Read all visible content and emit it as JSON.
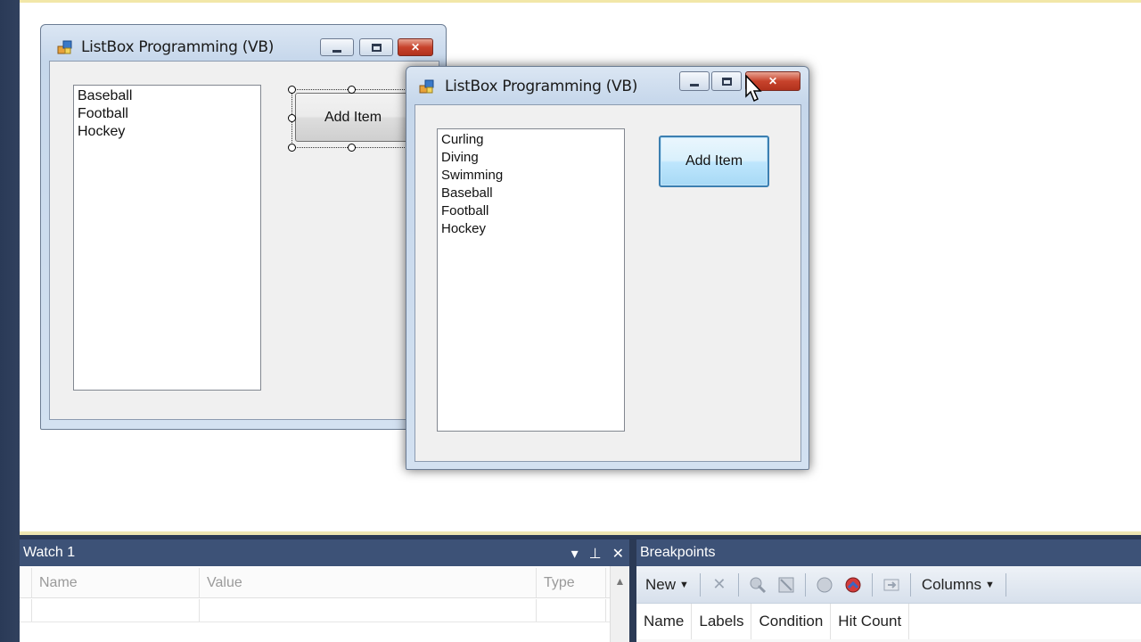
{
  "colors": {
    "ide_dark": "#2b3a55",
    "panel_header": "#3d5277",
    "designer_bg": "#ffffff",
    "focus_blue": "#3c7fb1",
    "close_red": "#c7432c"
  },
  "design_form": {
    "title": "ListBox Programming (VB)",
    "listbox_items": [
      "Baseball",
      "Football",
      "Hockey"
    ],
    "button_label": "Add Item"
  },
  "running_form": {
    "title": "ListBox Programming (VB)",
    "listbox_items": [
      "Curling",
      "Diving",
      "Swimming",
      "Baseball",
      "Football",
      "Hockey"
    ],
    "button_label": "Add Item"
  },
  "watch_panel": {
    "title": "Watch 1",
    "columns": [
      "Name",
      "Value",
      "Type"
    ]
  },
  "breakpoints_panel": {
    "title": "Breakpoints",
    "toolbar": {
      "new_label": "New",
      "columns_label": "Columns"
    },
    "columns": [
      "Name",
      "Labels",
      "Condition",
      "Hit Count"
    ]
  },
  "icons": [
    "app-form-icon",
    "minimize-icon",
    "maximize-icon",
    "close-icon",
    "mouse-cursor-icon",
    "dropdown-arrow-icon",
    "pin-icon",
    "delete-icon",
    "breakpoint-icon",
    "export-icon"
  ]
}
